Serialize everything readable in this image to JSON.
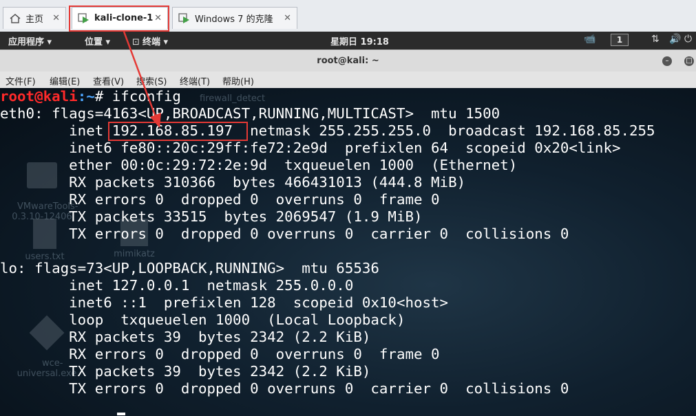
{
  "tabs": [
    {
      "label": "主页",
      "icon": "home-icon"
    },
    {
      "label": "kali-clone-1",
      "icon": "vm-play-icon"
    },
    {
      "label": "Windows 7 的克隆",
      "icon": "vm-play-icon"
    }
  ],
  "tab_close": "✕",
  "gnome": {
    "applications": "应用程序 ▾",
    "places": "位置 ▾",
    "terminal": "终端 ▾",
    "clock": "星期日 19:18",
    "workspace": "1"
  },
  "window": {
    "title": "root@kali: ~",
    "menu": [
      "文件(F)",
      "编辑(E)",
      "查看(V)",
      "搜索(S)",
      "终端(T)",
      "帮助(H)"
    ]
  },
  "desktop_ghosts": [
    "firewall_detect",
    "VMwareTools-\n0.3.10-12406",
    "users.txt",
    "mimikatz",
    "wce-\nuniversal.exe"
  ],
  "terminal": {
    "prompt_user": "root@kali",
    "prompt_path": ":~",
    "prompt_symbol": "# ",
    "command": "ifconfig",
    "lines": [
      "eth0: flags=4163<UP,BROADCAST,RUNNING,MULTICAST>  mtu 1500",
      "        inet 192.168.85.197  netmask 255.255.255.0  broadcast 192.168.85.255",
      "        inet6 fe80::20c:29ff:fe72:2e9d  prefixlen 64  scopeid 0x20<link>",
      "        ether 00:0c:29:72:2e:9d  txqueuelen 1000  (Ethernet)",
      "        RX packets 310366  bytes 466431013 (444.8 MiB)",
      "        RX errors 0  dropped 0  overruns 0  frame 0",
      "        TX packets 33515  bytes 2069547 (1.9 MiB)",
      "        TX errors 0  dropped 0 overruns 0  carrier 0  collisions 0",
      "",
      "lo: flags=73<UP,LOOPBACK,RUNNING>  mtu 65536",
      "        inet 127.0.0.1  netmask 255.0.0.0",
      "        inet6 ::1  prefixlen 128  scopeid 0x10<host>",
      "        loop  txqueuelen 1000  (Local Loopback)",
      "        RX packets 39  bytes 2342 (2.2 KiB)",
      "        RX errors 0  dropped 0  overruns 0  frame 0",
      "        TX packets 39  bytes 2342 (2.2 KiB)",
      "        TX errors 0  dropped 0 overruns 0  carrier 0  collisions 0"
    ]
  },
  "colors": {
    "annotation": "#e53935",
    "prompt_user": "#ff2a2a",
    "prompt_path": "#4da6ff"
  }
}
